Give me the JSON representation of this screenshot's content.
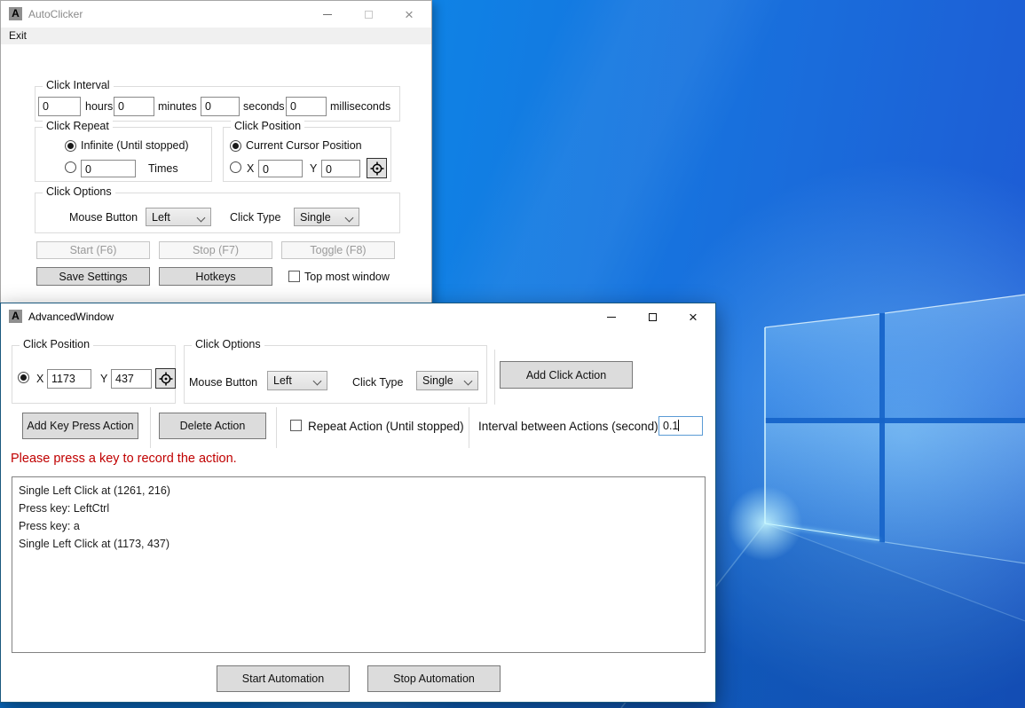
{
  "app": {
    "icon_letter": "A"
  },
  "autoclicker_window": {
    "title": "AutoClicker",
    "menu_exit": "Exit",
    "click_interval": {
      "label": "Click Interval",
      "hours_value": "0",
      "hours_label": "hours",
      "minutes_value": "0",
      "minutes_label": "minutes",
      "seconds_value": "0",
      "seconds_label": "seconds",
      "milliseconds_value": "0",
      "milliseconds_label": "milliseconds"
    },
    "click_repeat": {
      "label": "Click Repeat",
      "infinite_label": "Infinite (Until stopped)",
      "times_value": "0",
      "times_label": "Times"
    },
    "click_position": {
      "label": "Click Position",
      "current_cursor_label": "Current Cursor Position",
      "x_label": "X",
      "x_value": "0",
      "y_label": "Y",
      "y_value": "0"
    },
    "click_options": {
      "label": "Click Options",
      "mouse_button_label": "Mouse Button",
      "mouse_button_value": "Left",
      "click_type_label": "Click Type",
      "click_type_value": "Single"
    },
    "start_button": "Start (F6)",
    "stop_button": "Stop (F7)",
    "toggle_button": "Toggle (F8)",
    "save_settings_button": "Save Settings",
    "hotkeys_button": "Hotkeys",
    "top_most_label": "Top most window"
  },
  "advanced_window": {
    "title": "AdvancedWindow",
    "click_position": {
      "label": "Click Position",
      "x_label": "X",
      "x_value": "1173",
      "y_label": "Y",
      "y_value": "437"
    },
    "click_options": {
      "label": "Click Options",
      "mouse_button_label": "Mouse Button",
      "mouse_button_value": "Left",
      "click_type_label": "Click Type",
      "click_type_value": "Single"
    },
    "add_click_action_button": "Add Click Action",
    "add_key_press_button": "Add Key Press Action",
    "delete_action_button": "Delete Action",
    "repeat_action_label": "Repeat Action (Until stopped)",
    "interval_label": "Interval between Actions (second)",
    "interval_value": "0.1",
    "status_message": "Please press a key to record the action.",
    "actions": [
      "Single Left Click at (1261, 216)",
      "Press key: LeftCtrl",
      "Press key: a",
      "Single Left Click at (1173, 437)"
    ],
    "start_automation_button": "Start Automation",
    "stop_automation_button": "Stop Automation"
  },
  "colors": {
    "status_message": "#c00000",
    "focused_textbox_border": "#5b9bd5",
    "active_window_border": "#1a587e",
    "wallpaper_primary": "#0e84e6",
    "wallpaper_deep": "#1e58d3"
  }
}
